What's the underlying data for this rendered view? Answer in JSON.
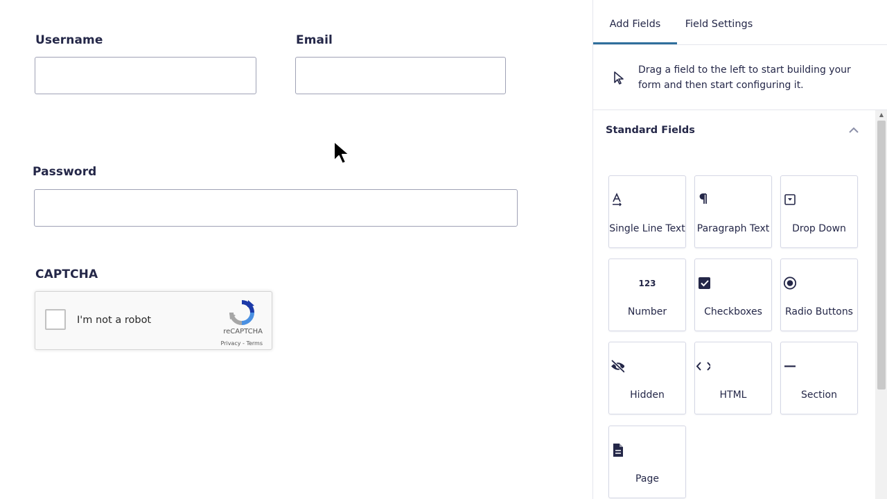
{
  "form": {
    "username_label": "Username",
    "email_label": "Email",
    "password_label": "Password",
    "captcha_label": "CAPTCHA",
    "recaptcha": {
      "checkbox_text": "I'm not a robot",
      "brand": "reCAPTCHA",
      "links": "Privacy - Terms"
    }
  },
  "panel": {
    "tabs": [
      {
        "label": "Add Fields",
        "active": true
      },
      {
        "label": "Field Settings",
        "active": false
      }
    ],
    "hint_text": "Drag a field to the left to start building your form and then start configuring it.",
    "section_title": "Standard Fields",
    "fields": [
      {
        "label": "Single Line Text",
        "icon": "single-line-text-icon"
      },
      {
        "label": "Paragraph Text",
        "icon": "paragraph-icon"
      },
      {
        "label": "Drop Down",
        "icon": "dropdown-icon"
      },
      {
        "label": "Number",
        "icon": "number-icon",
        "glyph": "123"
      },
      {
        "label": "Checkboxes",
        "icon": "checkbox-icon"
      },
      {
        "label": "Radio Buttons",
        "icon": "radio-icon"
      },
      {
        "label": "Hidden",
        "icon": "eye-off-icon"
      },
      {
        "label": "HTML",
        "icon": "code-icon"
      },
      {
        "label": "Section",
        "icon": "minus-icon"
      },
      {
        "label": "Page",
        "icon": "document-icon"
      }
    ]
  },
  "colors": {
    "accent": "#2f6f9c",
    "text": "#242748",
    "border": "#d5d7e5"
  }
}
